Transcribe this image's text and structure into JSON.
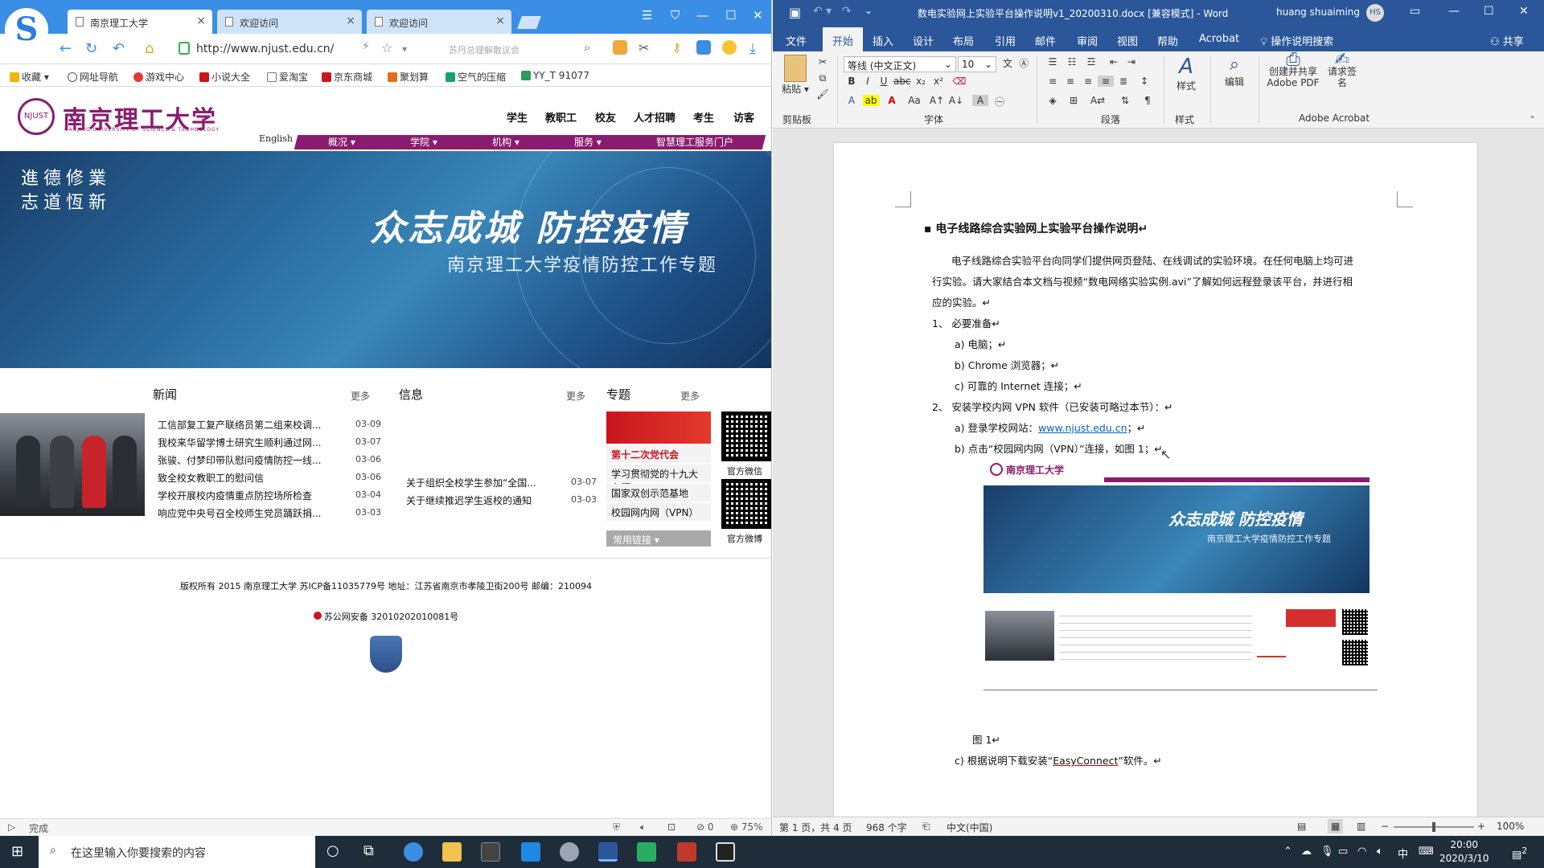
{
  "browser": {
    "tabs": [
      "南京理工大学",
      "欢迎访问",
      "欢迎访问"
    ],
    "url": "http://www.njust.edu.cn/",
    "search_placeholder": "苏丹总理解散议会",
    "bookmarks": [
      "收藏",
      "网址导航",
      "游戏中心",
      "小说大全",
      "爱淘宝",
      "京东商城",
      "聚划算",
      "空气的压缩",
      "YY_T 91077"
    ],
    "status_left": "完成",
    "status_zoom": "75%",
    "status_count": "0"
  },
  "site": {
    "name": "南京理工大学",
    "name_en": "NANJING UNIVERSITY OF SCIENCE & TECHNOLOGY",
    "top_links": [
      "学生",
      "教职工",
      "校友",
      "人才招聘",
      "考生",
      "访客"
    ],
    "english": "English",
    "menu": [
      "概况",
      "学院",
      "机构",
      "服务",
      "智慧理工服务门户"
    ],
    "banner": {
      "motto": [
        "進德修業",
        "志道恆新"
      ],
      "title": "众志成城  防控疫情",
      "subtitle": "南京理工大学疫情防控工作专题"
    },
    "news": {
      "title": "新闻",
      "more": "更多",
      "items": [
        {
          "text": "工信部复工复产联络员第二组来校调...",
          "date": "03-09"
        },
        {
          "text": "我校来华留学博士研究生顺利通过网...",
          "date": "03-07"
        },
        {
          "text": "张骏、付梦印带队慰问疫情防控一线...",
          "date": "03-06"
        },
        {
          "text": "致全校女教职工的慰问信",
          "date": "03-06"
        },
        {
          "text": "学校开展校内疫情重点防控场所检查",
          "date": "03-04"
        },
        {
          "text": "响应党中央号召全校师生党员踊跃捐...",
          "date": "03-03"
        }
      ]
    },
    "info": {
      "title": "信息",
      "more": "更多",
      "items": [
        {
          "text": "关于组织全校学生参加“全国...",
          "date": "03-07"
        },
        {
          "text": "关于继续推迟学生返校的通知",
          "date": "03-03"
        }
      ]
    },
    "special": {
      "title": "专题",
      "more": "更多",
      "banner_text": "第十二次党代会",
      "items": [
        "学习贯彻党的十九大专题",
        "国家双创示范基地",
        "校园网内网（VPN）"
      ],
      "common_links": "常用链接",
      "wechat": "官方微信",
      "weibo": "官方微博"
    },
    "footer": {
      "copyright": "版权所有 2015 南京理工大学 苏ICP备11035779号 地址：江苏省南京市孝陵卫街200号 邮编：210094",
      "police": "苏公网安备 32010202010081号"
    }
  },
  "word": {
    "title": "数电实验网上实验平台操作说明v1_20200310.docx [兼容模式] - Word",
    "user": "huang shuaiming",
    "user_initials": "HS",
    "tabs": [
      "文件",
      "开始",
      "插入",
      "设计",
      "布局",
      "引用",
      "邮件",
      "审阅",
      "视图",
      "帮助",
      "Acrobat",
      "操作说明搜索"
    ],
    "share": "共享",
    "ribbon": {
      "clipboard": "剪贴板",
      "paste": "粘贴",
      "font": "字体",
      "font_name": "等线 (中文正文)",
      "font_size": "10",
      "paragraph": "段落",
      "styles": "样式",
      "styles_btn": "样式",
      "edit_btn": "编辑",
      "acrobat": "Adobe Acrobat",
      "create_pdf": "创建并共享 Adobe PDF",
      "request_sign": "请求签名"
    },
    "doc": {
      "heading": "电子线路综合实验网上实验平台操作说明",
      "para1_line1": "电子线路综合实验平台向同学们提供网页登陆、在线调试的实验环境。在任何电脑上均可进",
      "para1_line2": "行实验。请大家结合本文档与视频“数电网络实验实例.avi”了解如何远程登录该平台，并进行相",
      "para1_line3": "应的实验。",
      "step1": "1、    必要准备",
      "step1_a": "a)    电脑；",
      "step1_b": "b)    Chrome 浏览器；",
      "step1_c": "c)    可靠的 Internet 连接；",
      "step2": "2、    安装学校内网 VPN 软件（已安装可略过本节）：",
      "step2_a_label": "a)    登录学校网站：",
      "step2_a_link": "www.njust.edu.cn",
      "step2_b": "b)    点击“校园网内网（VPN）”连接，如图 1；",
      "figure_caption": "图 1",
      "step2_c_label": "c)    根据说明下载安装“",
      "step2_c_link": "EasyConnect",
      "step2_c_tail": "”软件。"
    },
    "status": {
      "page": "第 1 页，共 4 页",
      "words": "968 个字",
      "lang": "中文(中国)",
      "zoom": "100%"
    }
  },
  "taskbar": {
    "search_placeholder": "在这里输入你要搜索的内容",
    "time": "20:00",
    "date": "2020/3/10",
    "ime": "中",
    "notifications": "2"
  }
}
